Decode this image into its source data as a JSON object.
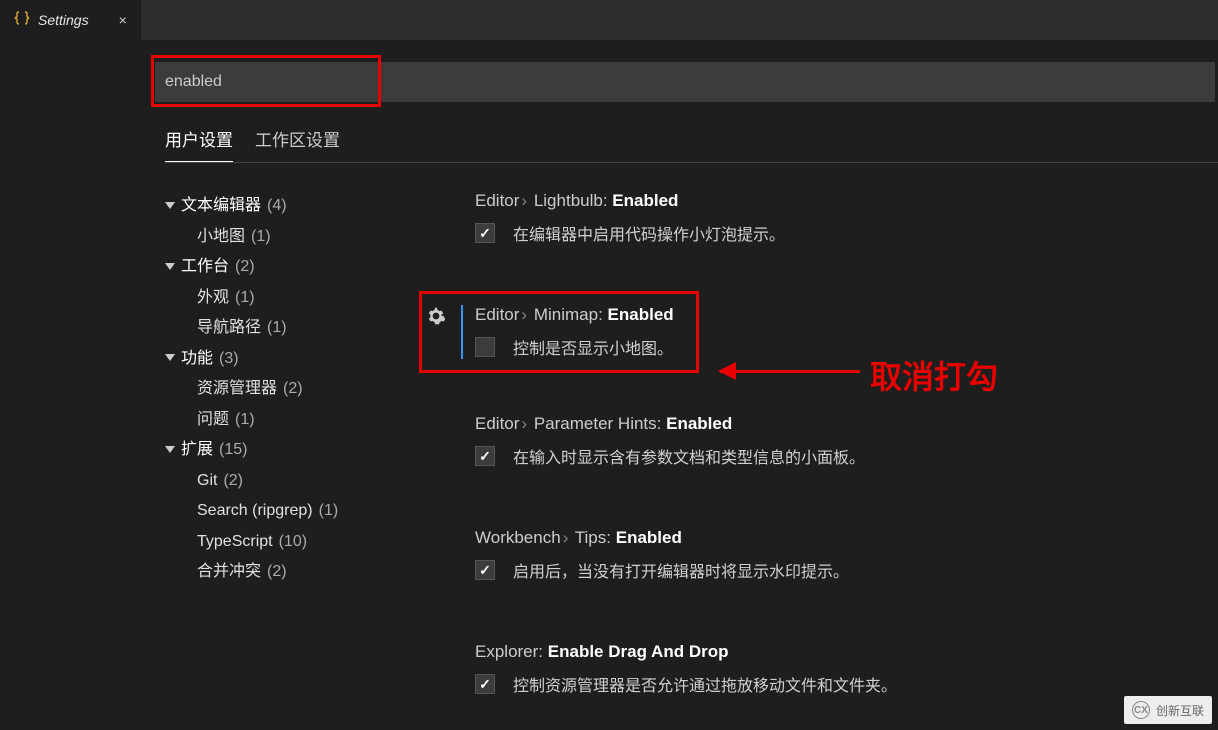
{
  "tab": {
    "title": "Settings",
    "close": "×"
  },
  "search": {
    "value": "enabled"
  },
  "tabs": {
    "user": "用户设置",
    "workspace": "工作区设置"
  },
  "tree": [
    {
      "label": "文本编辑器",
      "count": "(4)",
      "children": [
        {
          "label": "小地图",
          "count": "(1)"
        }
      ]
    },
    {
      "label": "工作台",
      "count": "(2)",
      "children": [
        {
          "label": "外观",
          "count": "(1)"
        },
        {
          "label": "导航路径",
          "count": "(1)"
        }
      ]
    },
    {
      "label": "功能",
      "count": "(3)",
      "children": [
        {
          "label": "资源管理器",
          "count": "(2)"
        },
        {
          "label": "问题",
          "count": "(1)"
        }
      ]
    },
    {
      "label": "扩展",
      "count": "(15)",
      "children": [
        {
          "label": "Git",
          "count": "(2)"
        },
        {
          "label": "Search (ripgrep)",
          "count": "(1)"
        },
        {
          "label": "TypeScript",
          "count": "(10)"
        },
        {
          "label": "合并冲突",
          "count": "(2)"
        }
      ]
    }
  ],
  "settings": {
    "lightbulb": {
      "path_a": "Editor",
      "path_b": "Lightbulb:",
      "last": "Enabled",
      "desc": "在编辑器中启用代码操作小灯泡提示。",
      "checked": true
    },
    "minimap": {
      "path_a": "Editor",
      "path_b": "Minimap:",
      "last": "Enabled",
      "desc": "控制是否显示小地图。",
      "checked": false
    },
    "paramhints": {
      "path_a": "Editor",
      "path_b": "Parameter Hints:",
      "last": "Enabled",
      "desc": "在输入时显示含有参数文档和类型信息的小面板。",
      "checked": true
    },
    "tips": {
      "path_a": "Workbench",
      "path_b": "Tips:",
      "last": "Enabled",
      "desc": "启用后，当没有打开编辑器时将显示水印提示。",
      "checked": true
    },
    "dragdrop": {
      "path_a": "Explorer:",
      "last": "Enable Drag And Drop",
      "desc": "控制资源管理器是否允许通过拖放移动文件和文件夹。",
      "checked": true
    }
  },
  "annotation": {
    "text": "取消打勾"
  },
  "watermark": "创新互联"
}
